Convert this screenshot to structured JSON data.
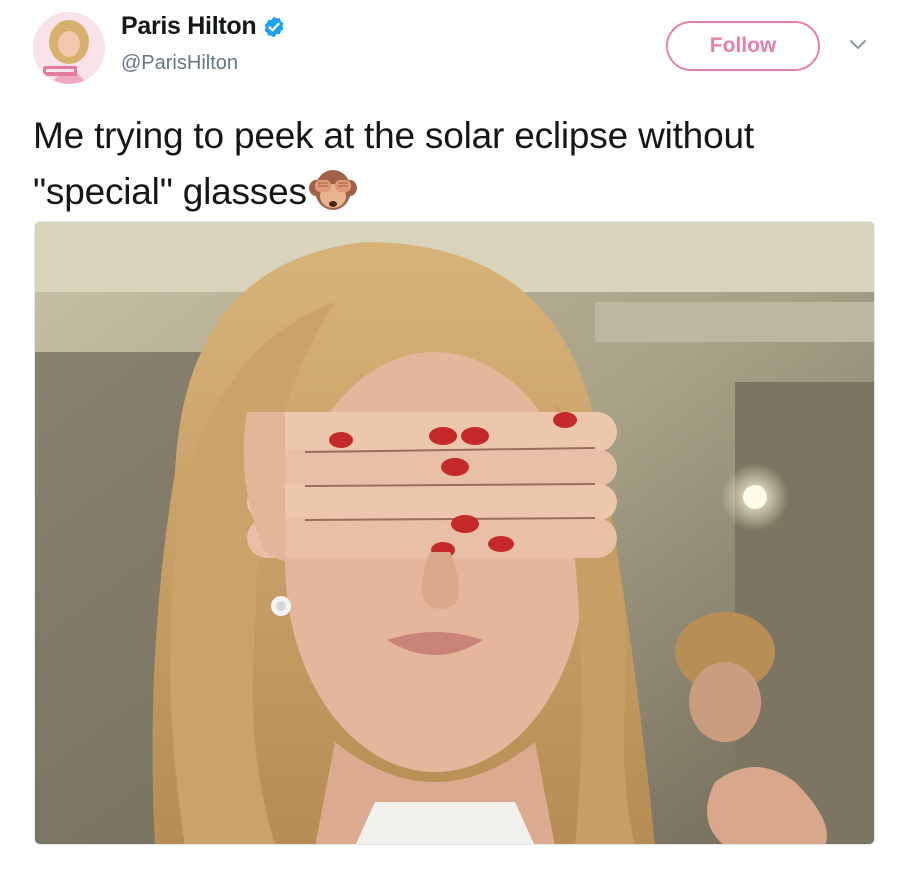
{
  "user": {
    "display_name": "Paris Hilton",
    "handle": "@ParisHilton",
    "verified": true,
    "avatar_icon": "profile-photo"
  },
  "actions": {
    "follow_label": "Follow",
    "more_icon": "chevron-down-icon"
  },
  "tweet": {
    "text": "Me trying to peek at the solar eclipse without \"special\" glasses",
    "emoji": "see-no-evil-monkey"
  },
  "media": {
    "type": "photo"
  },
  "colors": {
    "brand_pink": "#e87fa9",
    "verified_blue": "#1da1f2",
    "text_primary": "#14171a",
    "text_secondary": "#657786"
  }
}
